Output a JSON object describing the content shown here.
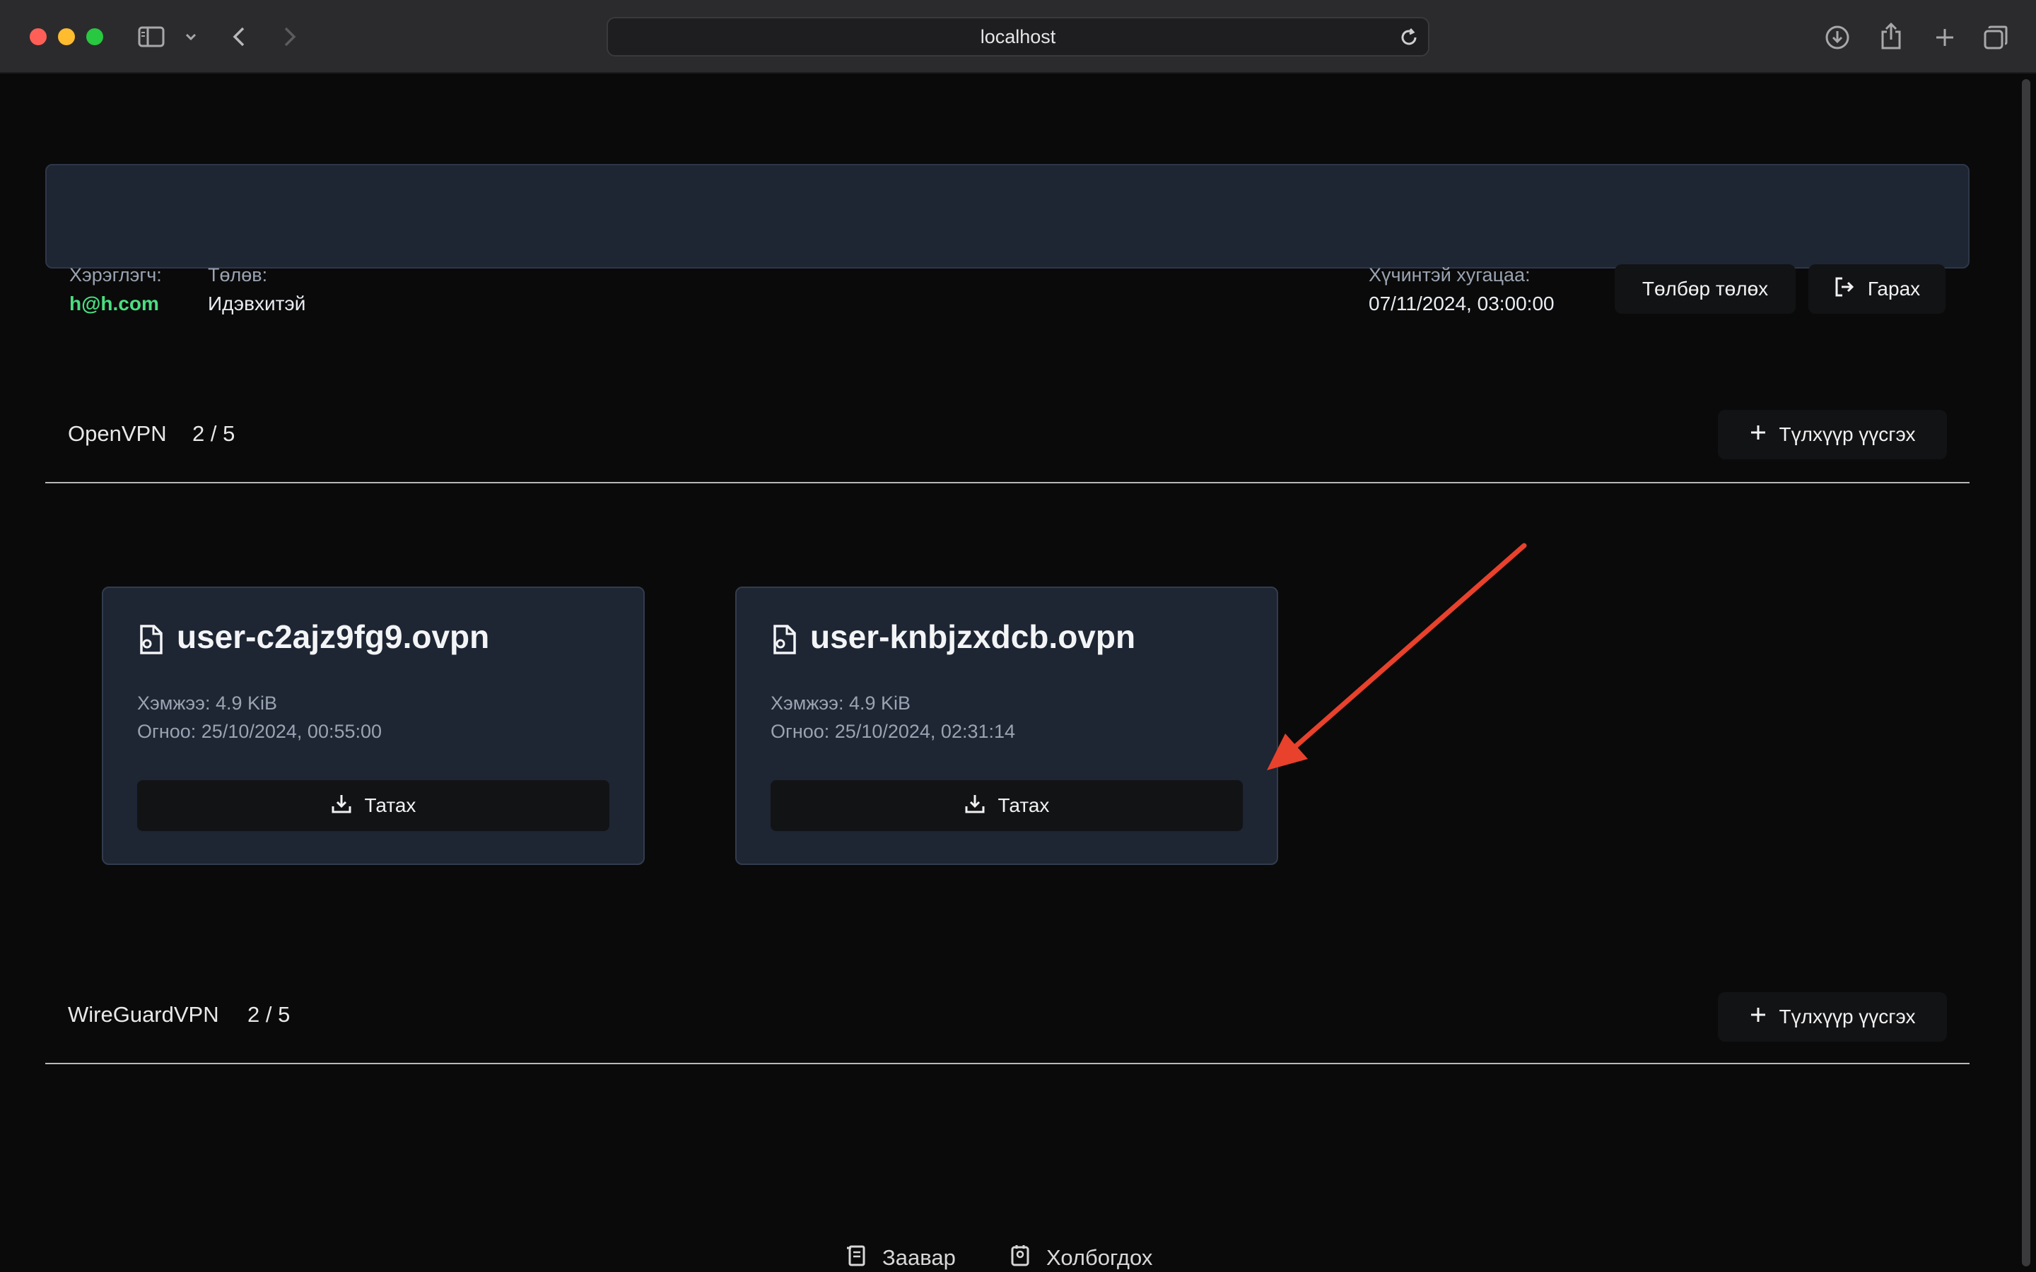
{
  "browser": {
    "url": "localhost"
  },
  "user_bar": {
    "user_label": "Хэрэглэгч:",
    "user_email": "h@h.com",
    "status_label": "Төлөв:",
    "status_value": "Идэвхитэй",
    "expiry_label": "Хүчинтэй хугацаа:",
    "expiry_value": "07/11/2024, 03:00:00",
    "pay_button": "Төлбөр төлөх",
    "logout_button": "Гарах"
  },
  "openvpn": {
    "title": "OpenVPN",
    "count": "2 / 5",
    "add_button": "Түлхүүр үүсгэх",
    "cards": [
      {
        "filename": "user-c2ajz9fg9.ovpn",
        "size": "Хэмжээ: 4.9 KiB",
        "date": "Огноо: 25/10/2024, 00:55:00",
        "download": "Татах"
      },
      {
        "filename": "user-knbjzxdcb.ovpn",
        "size": "Хэмжээ: 4.9 KiB",
        "date": "Огноо: 25/10/2024, 02:31:14",
        "download": "Татах"
      }
    ]
  },
  "wireguard": {
    "title": "WireGuardVPN",
    "count": "2 / 5",
    "add_button": "Түлхүүр үүсгэх"
  },
  "footer": {
    "guide": "Заавар",
    "contact": "Холбогдох"
  },
  "colors": {
    "background": "#0a0a0a",
    "panel": "#1e2533",
    "button": "#121315",
    "email_accent": "#4ade80",
    "annotation_arrow": "#e8412c"
  },
  "icons": [
    "sidebar-icon",
    "chevron-down-icon",
    "back-icon",
    "forward-icon",
    "reload-icon",
    "download-icon",
    "share-icon",
    "plus-icon",
    "tabs-icon",
    "logout-icon",
    "file-icon",
    "guide-icon",
    "contact-icon"
  ]
}
